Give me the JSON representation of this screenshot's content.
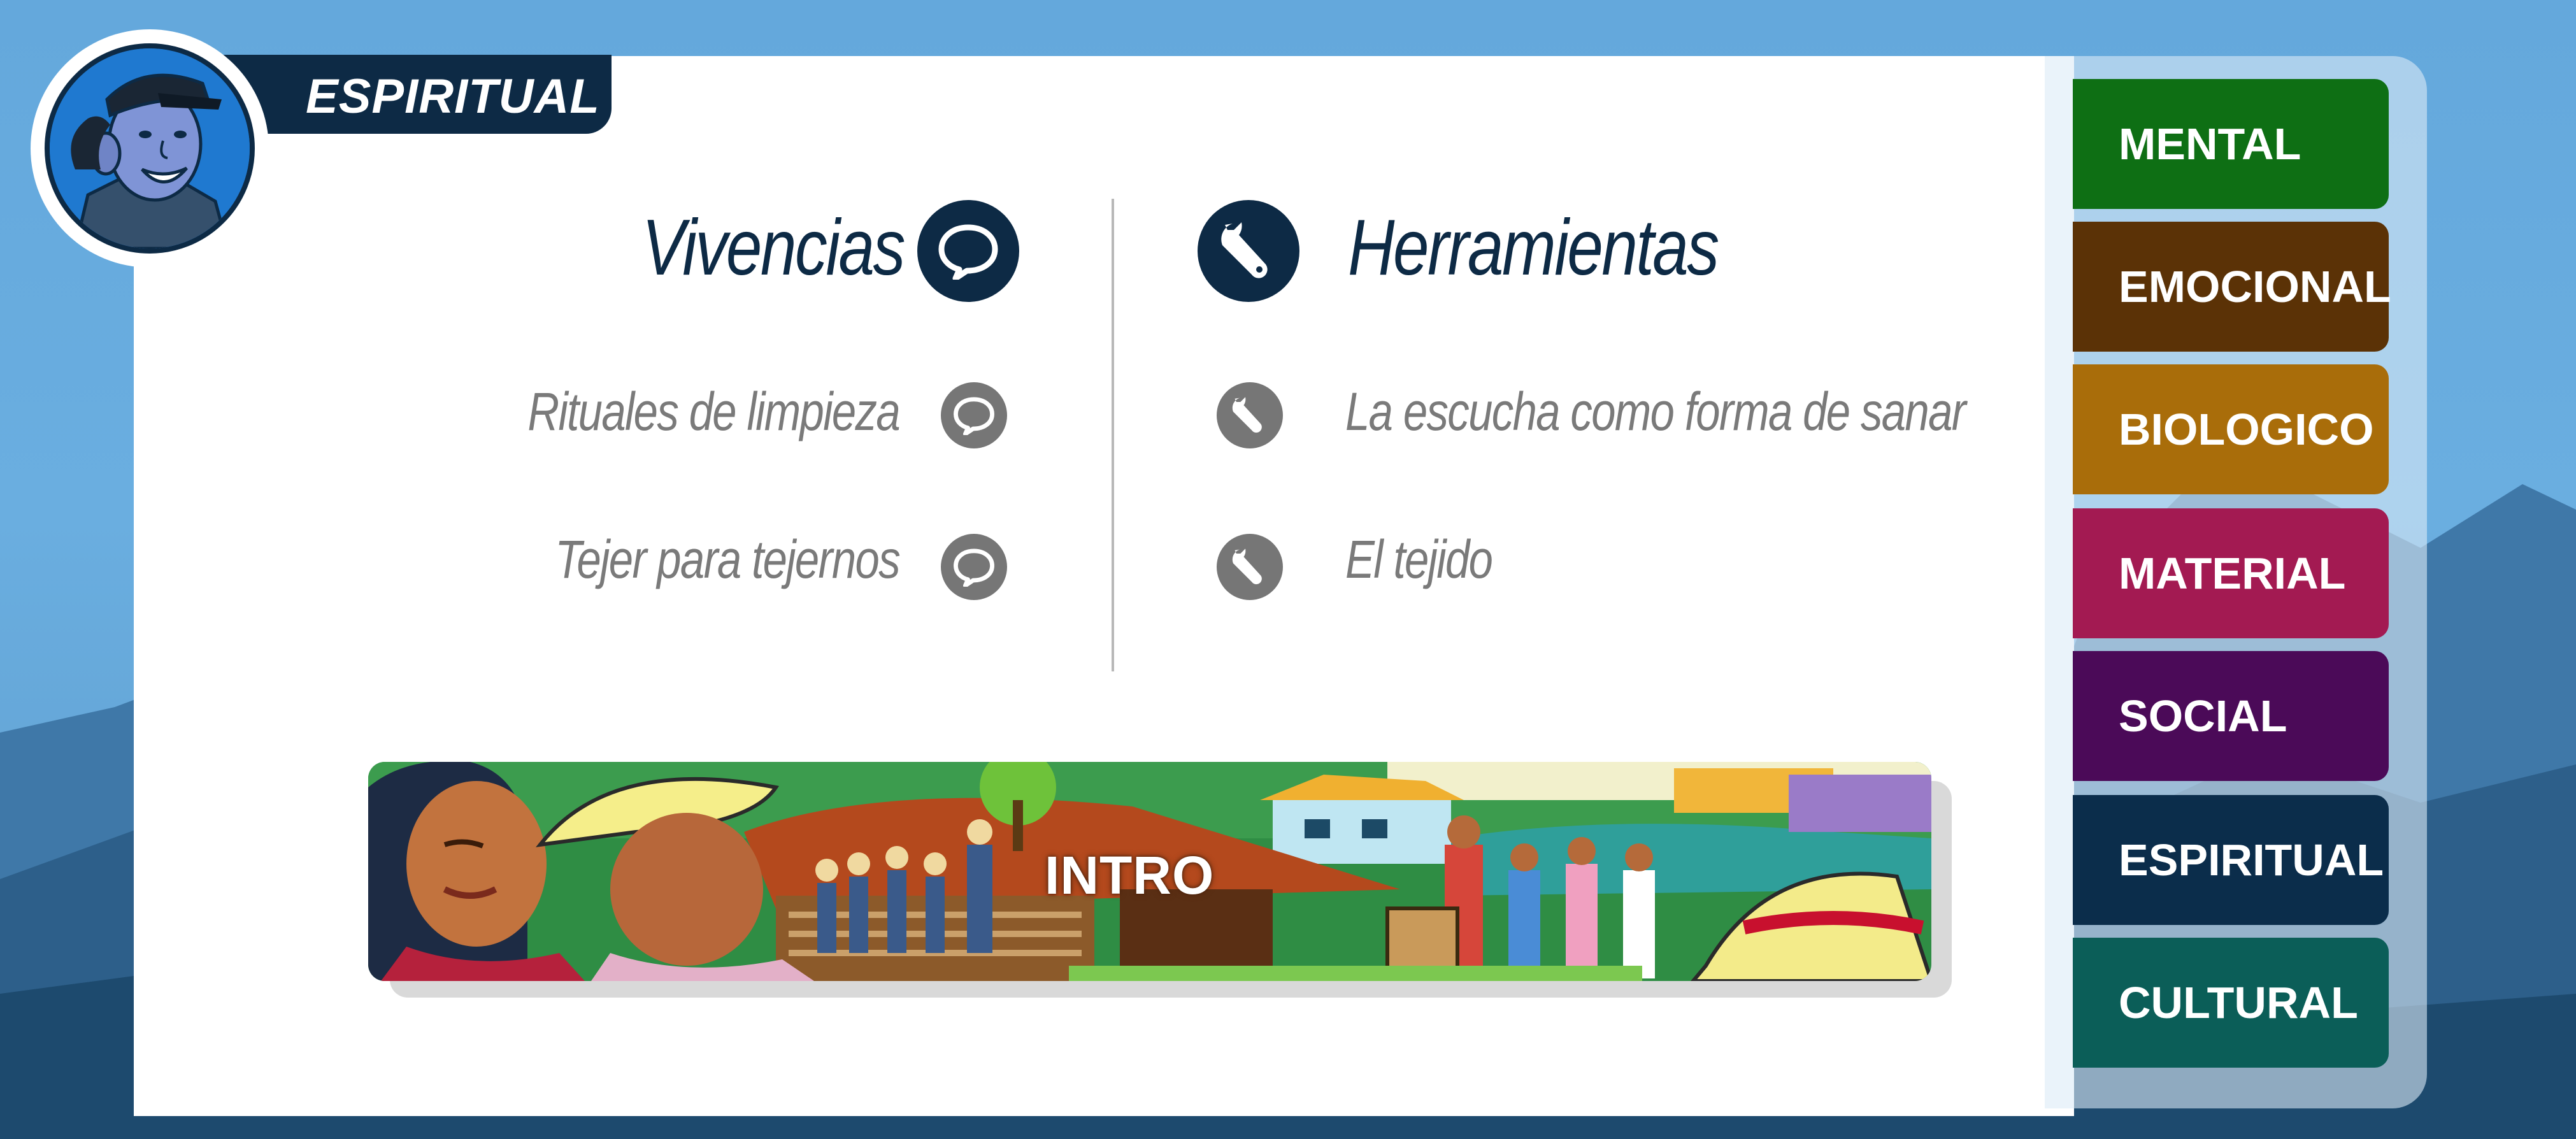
{
  "header": {
    "section_title": "ESPIRITUAL"
  },
  "columns": {
    "vivencias": {
      "title": "Vivencias",
      "icon": "speech-bubble-icon",
      "items": [
        {
          "label": "Rituales de limpieza"
        },
        {
          "label": "Tejer para tejernos"
        }
      ]
    },
    "herramientas": {
      "title": "Herramientas",
      "icon": "wrench-icon",
      "items": [
        {
          "label": "La escucha como forma de sanar"
        },
        {
          "label": "El tejido"
        }
      ]
    }
  },
  "banner": {
    "label": "INTRO"
  },
  "sidebar": {
    "items": [
      {
        "label": "MENTAL",
        "color": "#0e6f14"
      },
      {
        "label": "EMOCIONAL",
        "color": "#5b3206"
      },
      {
        "label": "BIOLOGICO",
        "color": "#a96d0a"
      },
      {
        "label": "MATERIAL",
        "color": "#a31a52"
      },
      {
        "label": "SOCIAL",
        "color": "#4b0a58"
      },
      {
        "label": "ESPIRITUAL",
        "color": "#0b2d4b"
      },
      {
        "label": "CULTURAL",
        "color": "#0b5e58"
      }
    ]
  },
  "colors": {
    "primary_dark": "#0d2a45",
    "secondary_text": "#7a7a7a",
    "background_sky": "#64a8dc"
  }
}
